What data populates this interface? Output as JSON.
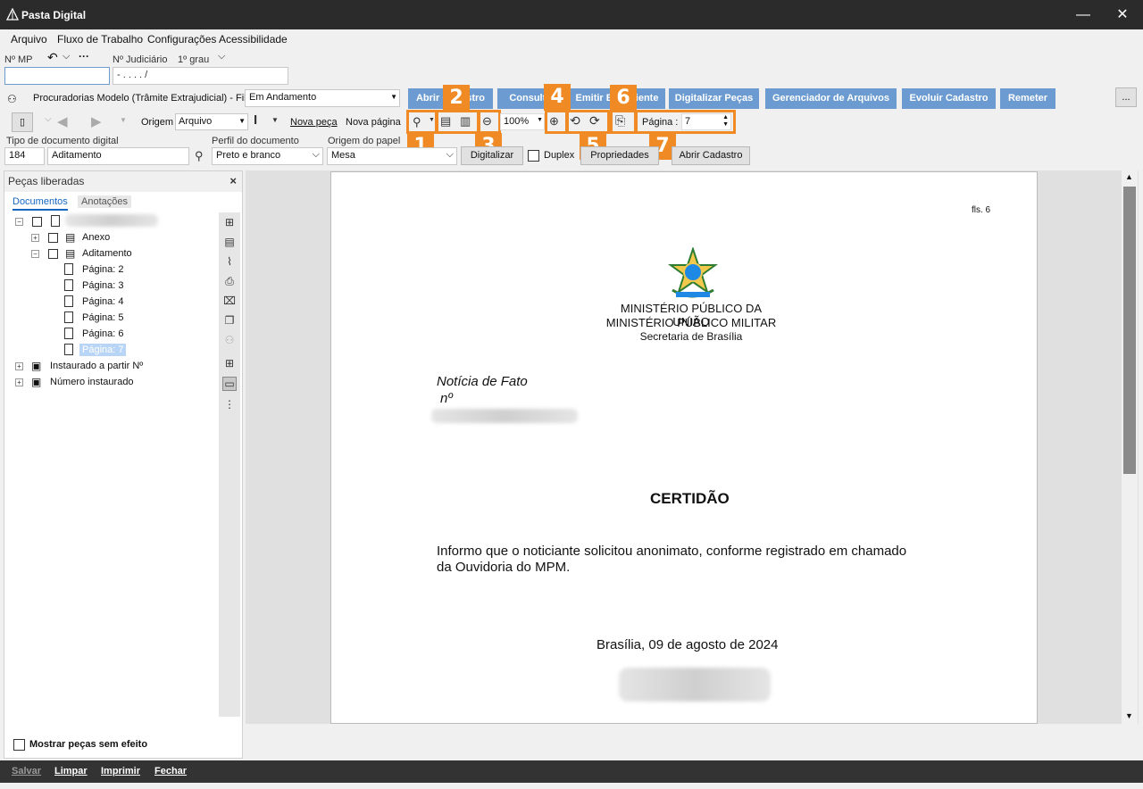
{
  "window": {
    "title": "Pasta Digital",
    "minimize": "—",
    "close": "✕"
  },
  "menu": [
    "Arquivo",
    "Fluxo de Trabalho",
    "Configurações",
    "Acessibilidade"
  ],
  "header": {
    "mp_label": "Nº MP",
    "judicial_label": "Nº Judiciário",
    "grau": "1º grau",
    "judicial_value": "- .   .  .  .   /",
    "fila_label": "Procuradorias Modelo (Trâmite Extrajudicial) - Fila",
    "fila_value": "Em Andamento",
    "more": "..."
  },
  "action_buttons": [
    "Abrir Cadastro",
    "Consultar",
    "Emitir Expediente",
    "Digitalizar Peças",
    "Gerenciador de Arquivos",
    "Evoluir Cadastro",
    "Remeter"
  ],
  "toolbar": {
    "origem_label": "Origem",
    "origem_value": "Arquivo",
    "nova_peca": "Nova peça",
    "nova_pagina": "Nova página",
    "zoom": "100%",
    "pagina_label": "Página :",
    "pagina_value": "7"
  },
  "callouts": [
    "1",
    "2",
    "3",
    "4",
    "5",
    "6",
    "7"
  ],
  "docform": {
    "tipo_label": "Tipo de documento digital",
    "tipo_code": "184",
    "tipo_value": "Aditamento",
    "perfil_label": "Perfil do documento",
    "perfil_value": "Preto e branco",
    "origem_papel_label": "Origem do papel",
    "origem_papel_value": "Mesa",
    "digitalizar": "Digitalizar",
    "duplex": "Duplex",
    "propriedades": "Propriedades",
    "abrir_cadastro": "Abrir Cadastro"
  },
  "left_panel": {
    "title": "Peças liberadas",
    "tabs": [
      "Documentos",
      "Anotações"
    ],
    "tree": {
      "anexo": "Anexo",
      "aditamento": "Aditamento",
      "pages": [
        "Página: 2",
        "Página: 3",
        "Página: 4",
        "Página: 5",
        "Página: 6",
        "Página: 7"
      ],
      "instaurado": "Instaurado a partir Nº",
      "numero": "Número instaurado"
    },
    "mostrar": "Mostrar peças sem efeito"
  },
  "document": {
    "fls": "fls. 6",
    "org1": "MINISTÉRIO PÚBLICO DA UNIÃO",
    "org2": "MINISTÉRIO PÚBLICO MILITAR",
    "org3": "Secretaria de Brasília",
    "noticia": "Notícia de Fato",
    "no": "nº",
    "certidao": "CERTIDÃO",
    "body1": "Informo que o noticiante solicitou anonimato, conforme registrado em chamado",
    "body2": "da Ouvidoria do MPM.",
    "date": "Brasília, 09 de agosto de 2024"
  },
  "bottom": [
    "Salvar",
    "Limpar",
    "Imprimir",
    "Fechar"
  ],
  "colors": {
    "accent": "#ef8a24",
    "button_blue": "#6b9bd1",
    "titlebar": "#2b2b2b"
  }
}
